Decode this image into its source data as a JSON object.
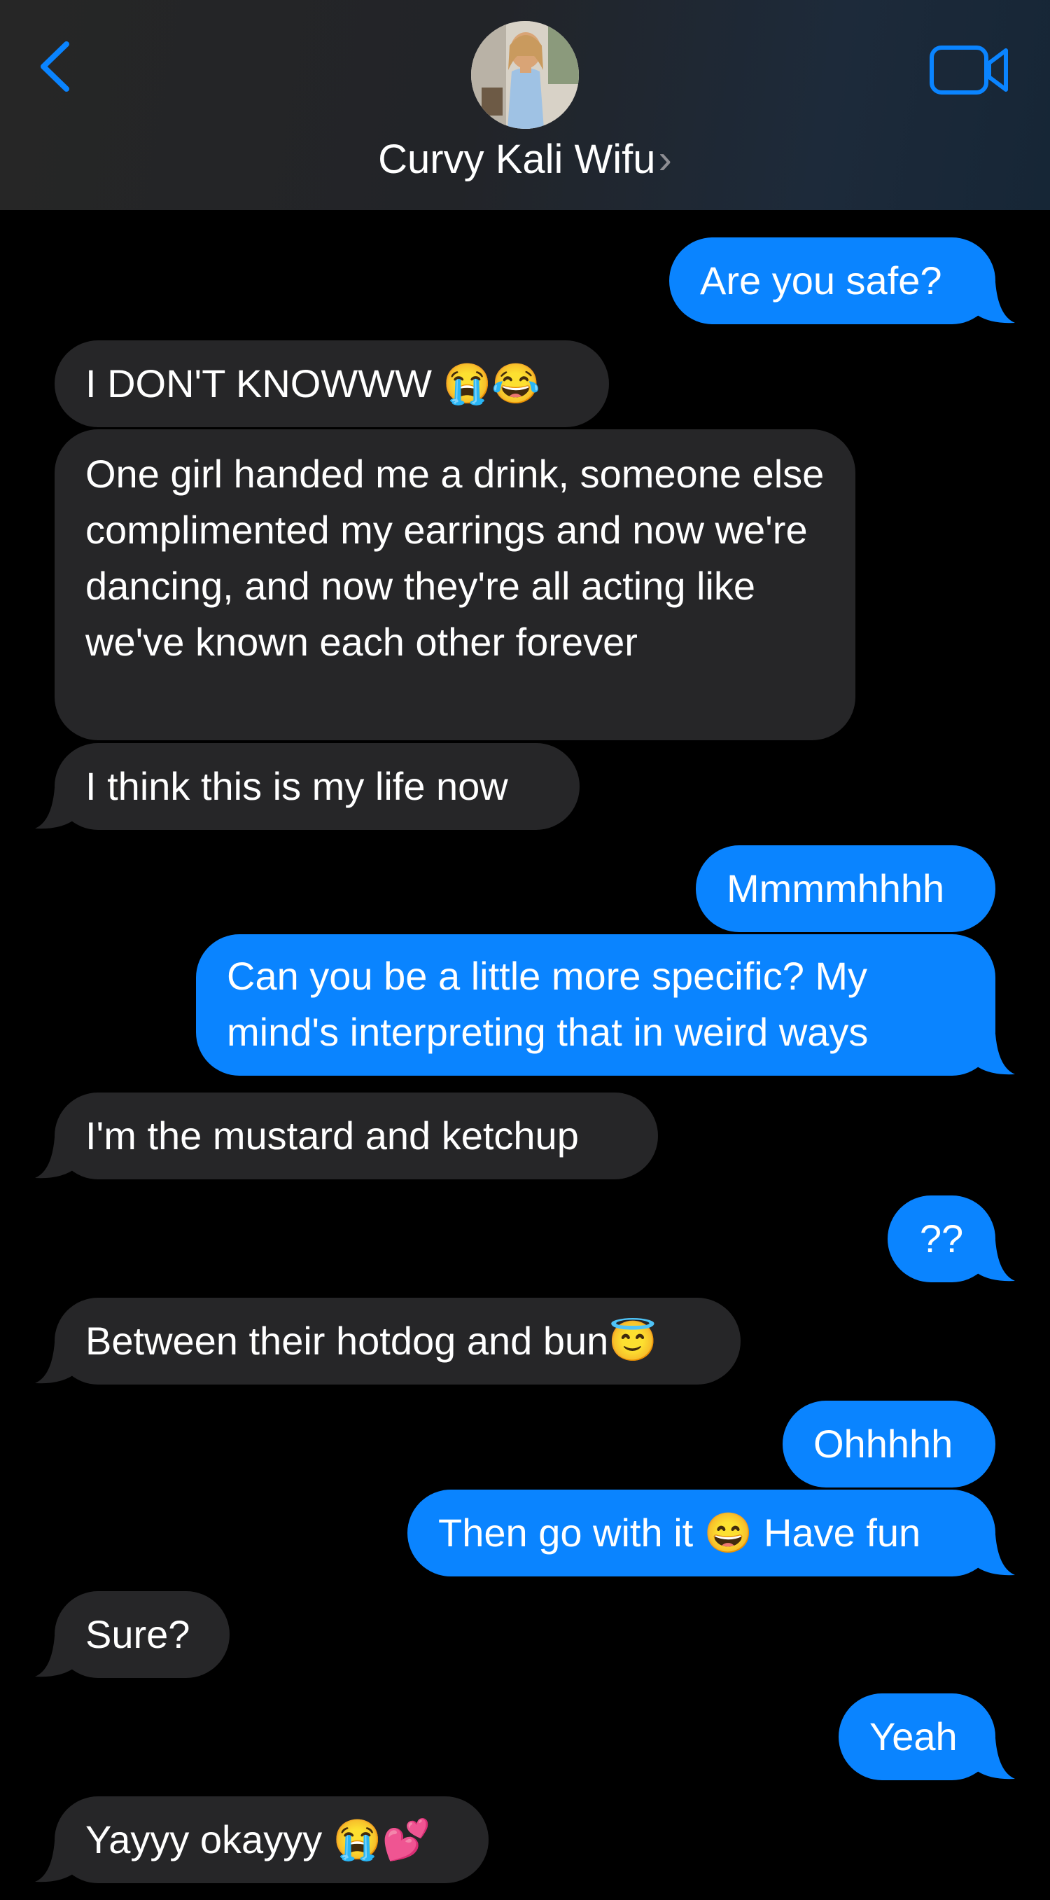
{
  "header": {
    "contact_name": "Curvy Kali Wifu",
    "chevron": "›",
    "back_icon": "chevron-left-icon",
    "video_icon": "video-camera-icon",
    "accent_color": "#0a84ff"
  },
  "colors": {
    "incoming_bubble": "#262628",
    "outgoing_bubble": "#0a84ff",
    "background": "#000000"
  },
  "messages": [
    {
      "dir": "out",
      "text": "Are you safe?"
    },
    {
      "dir": "in",
      "text": "I DON'T KNOWWW 😭😂"
    },
    {
      "dir": "in",
      "text": "One girl handed me a drink, someone else complimented my earrings and now we're dancing, and now they're all acting like we've known each other forever"
    },
    {
      "dir": "in",
      "text": "I think this is my life now"
    },
    {
      "dir": "out",
      "text": "Mmmmhhhh"
    },
    {
      "dir": "out",
      "text": "Can you be a little more specific? My mind's interpreting that in weird ways"
    },
    {
      "dir": "in",
      "text": "I'm the mustard and ketchup"
    },
    {
      "dir": "out",
      "text": "??"
    },
    {
      "dir": "in",
      "text": "Between their hotdog and bun😇"
    },
    {
      "dir": "out",
      "text": "Ohhhhh"
    },
    {
      "dir": "out",
      "text": "Then go with it 😄 Have fun"
    },
    {
      "dir": "in",
      "text": "Sure?"
    },
    {
      "dir": "out",
      "text": "Yeah"
    },
    {
      "dir": "in",
      "text": "Yayyy okayyy 😭💕"
    }
  ]
}
